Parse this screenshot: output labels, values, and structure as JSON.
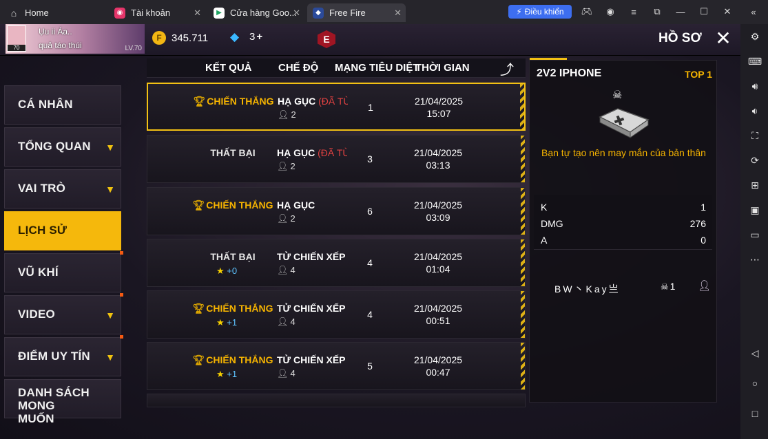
{
  "emulator": {
    "tabs": [
      {
        "label": "Home"
      },
      {
        "label": "Tài khoản"
      },
      {
        "label": "Cửa hàng Goo..."
      },
      {
        "label": "Free Fire"
      }
    ],
    "control_button": "Điều khiển"
  },
  "header": {
    "player_name": "Ụu ii Áa..",
    "player_subtitle": "quả táo thúi",
    "avatar_level": "70",
    "level_label": "LV.70",
    "gold": "345.711",
    "diamonds": "3",
    "diamond_plus": "+",
    "badge_letter": "E",
    "title": "HỒ SƠ"
  },
  "nav": [
    {
      "label": "CÁ NHÂN"
    },
    {
      "label": "TỔNG QUAN"
    },
    {
      "label": "VAI TRÒ"
    },
    {
      "label": "LỊCH SỬ"
    },
    {
      "label": "VŨ KHÍ"
    },
    {
      "label": "VIDEO"
    },
    {
      "label": "ĐIỂM UY TÍN"
    },
    {
      "label": "DANH SÁCH MONG MUỐN"
    }
  ],
  "table": {
    "headers": [
      "KẾT QUẢ",
      "CHẾ ĐỘ",
      "MẠNG TIÊU DIỆT",
      "THỜI GIAN"
    ],
    "rows": [
      {
        "result": "CHIẾN THẮNG",
        "rank": "",
        "mode": "HẠ GỤC",
        "abandoned": "(ĐÃ TỪ B",
        "players": "2",
        "kills": "1",
        "date": "21/04/2025",
        "time": "15:07"
      },
      {
        "result": "THẤT BẠI",
        "rank": "",
        "mode": "HẠ GỤC",
        "abandoned": "(ĐÃ TỪ B",
        "players": "2",
        "kills": "3",
        "date": "21/04/2025",
        "time": "03:13"
      },
      {
        "result": "CHIẾN THẮNG",
        "rank": "",
        "mode": "HẠ GỤC",
        "abandoned": "",
        "players": "2",
        "kills": "6",
        "date": "21/04/2025",
        "time": "03:09"
      },
      {
        "result": "THẤT BẠI",
        "rank": "+0",
        "mode": "TỬ CHIẾN XẾP HẠ",
        "abandoned": "",
        "players": "4",
        "kills": "4",
        "date": "21/04/2025",
        "time": "01:04"
      },
      {
        "result": "CHIẾN THẮNG",
        "rank": "+1",
        "mode": "TỬ CHIẾN XẾP HẠ",
        "abandoned": "",
        "players": "4",
        "kills": "4",
        "date": "21/04/2025",
        "time": "00:51"
      },
      {
        "result": "CHIẾN THẮNG",
        "rank": "+1",
        "mode": "TỬ CHIẾN XẾP HẠ",
        "abandoned": "",
        "players": "4",
        "kills": "5",
        "date": "21/04/2025",
        "time": "00:47"
      }
    ]
  },
  "detail": {
    "title": "2V2 IPHONE",
    "top": "TOP 1",
    "slogan": "Bạn tự tạo nên may mắn của bản thân",
    "stats": [
      {
        "label": "K",
        "value": "1"
      },
      {
        "label": "DMG",
        "value": "276"
      },
      {
        "label": "A",
        "value": "0"
      }
    ],
    "player": "BW丶Kay亗",
    "player_kills": "1"
  },
  "colors": {
    "accent": "#f3c114",
    "win": "#f6b400",
    "abandon": "#e14141",
    "emulator_blue": "#3d6ef0"
  }
}
